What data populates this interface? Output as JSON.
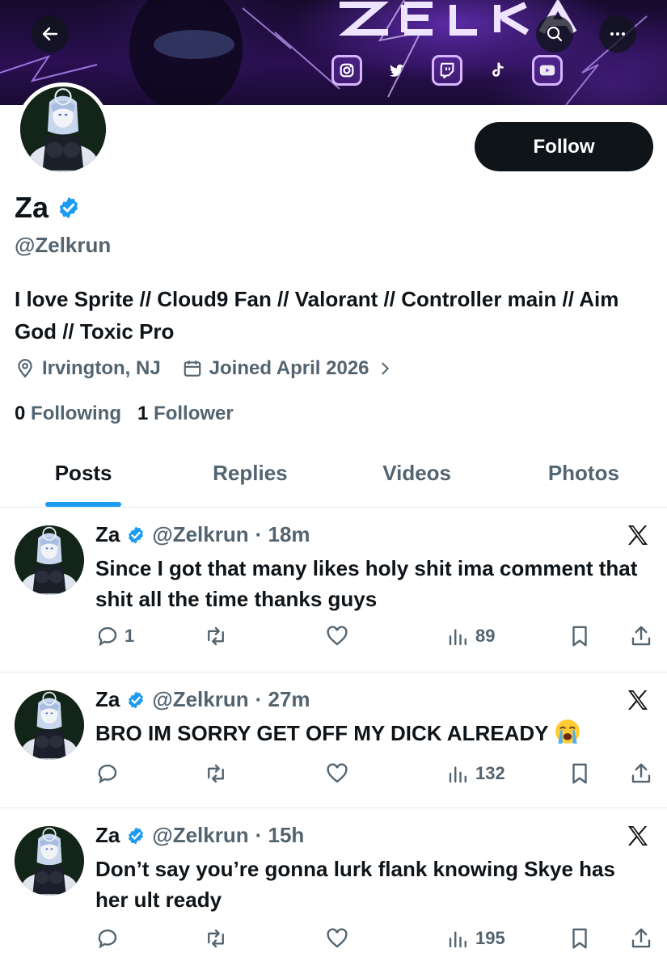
{
  "banner": {
    "back_icon": "arrow-left-icon",
    "search_icon": "search-icon",
    "more_icon": "more-icon",
    "socials": [
      "instagram-icon",
      "twitter-icon",
      "twitch-icon",
      "tiktok-icon",
      "youtube-icon"
    ]
  },
  "profile": {
    "display_name": "Za",
    "handle": "@Zelkrun",
    "follow_label": "Follow",
    "bio": "I love Sprite // Cloud9 Fan // Valorant // Controller main // Aim God // Toxic Pro",
    "location": "Irvington, NJ",
    "joined": "Joined April 2026",
    "following_count": "0",
    "following_label": "Following",
    "followers_count": "1",
    "followers_label": "Follower"
  },
  "tabs": [
    {
      "label": "Posts",
      "active": true
    },
    {
      "label": "Replies",
      "active": false
    },
    {
      "label": "Videos",
      "active": false
    },
    {
      "label": "Photos",
      "active": false
    }
  ],
  "posts": [
    {
      "name": "Za",
      "handle": "@Zelkrun",
      "time": "· 18m",
      "text": "Since I got that many likes holy shit ima comment that shit all the time thanks guys",
      "replies": "1",
      "views": "89"
    },
    {
      "name": "Za",
      "handle": "@Zelkrun",
      "time": "· 27m",
      "text": "BRO IM SORRY GET OFF MY DICK ALREADY",
      "emoji": "loudly-crying-face-emoji",
      "replies": "",
      "views": "132"
    },
    {
      "name": "Za",
      "handle": "@Zelkrun",
      "time": "· 15h",
      "text": "Don’t say you’re gonna lurk flank knowing Skye has her ult ready",
      "replies": "",
      "views": "195"
    }
  ],
  "colors": {
    "accent": "#1d9bf0",
    "text_primary": "#0f1419",
    "text_secondary": "#536471",
    "follow_bg": "#0f1419"
  }
}
